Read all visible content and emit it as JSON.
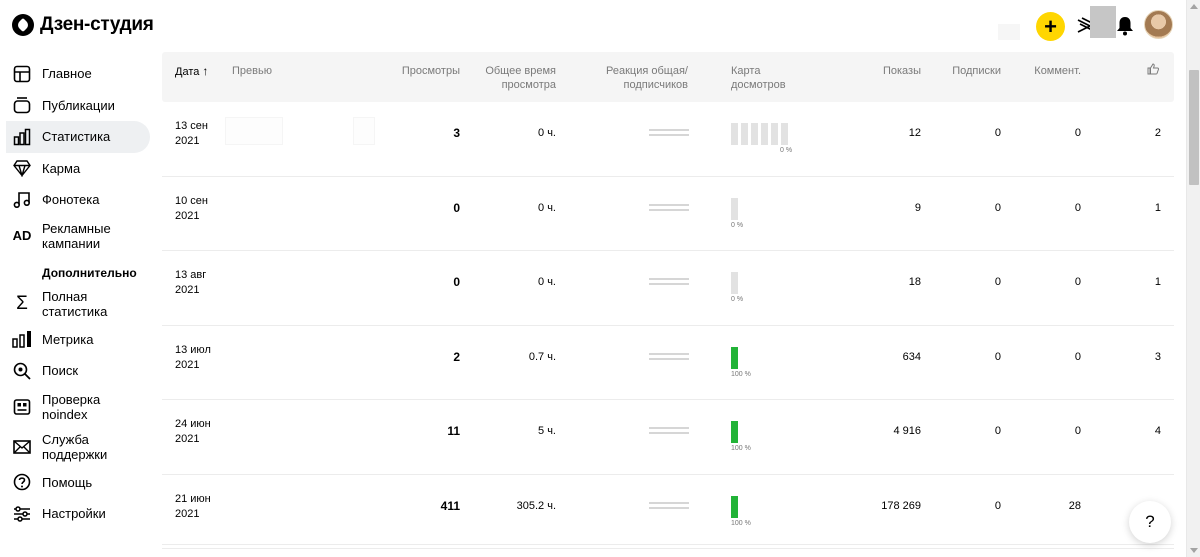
{
  "app": {
    "title": "Дзен-студия"
  },
  "header": {
    "plus_label": "+",
    "help_label": "?"
  },
  "sidebar": {
    "items": [
      {
        "label": "Главное",
        "icon": "layout-icon"
      },
      {
        "label": "Публикации",
        "icon": "publications-icon"
      },
      {
        "label": "Статистика",
        "icon": "bar-chart-icon",
        "active": true
      },
      {
        "label": "Карма",
        "icon": "diamond-icon"
      },
      {
        "label": "Фонотека",
        "icon": "music-icon"
      },
      {
        "label": "Рекламные кампании",
        "icon": "ad-icon",
        "glyph": "AD"
      }
    ],
    "section_title": "Дополнительно",
    "extra_items": [
      {
        "label": "Полная статистика",
        "icon": "sigma-icon",
        "glyph": "Σ"
      },
      {
        "label": "Метрика",
        "icon": "metrika-icon"
      },
      {
        "label": "Поиск",
        "icon": "search-icon"
      },
      {
        "label": "Проверка noindex",
        "icon": "noindex-icon"
      },
      {
        "label": "Служба поддержки",
        "icon": "mail-icon"
      },
      {
        "label": "Помощь",
        "icon": "question-icon"
      },
      {
        "label": "Настройки",
        "icon": "sliders-icon"
      }
    ]
  },
  "table": {
    "columns": {
      "date": "Дата",
      "preview": "Превью",
      "views": "Просмотры",
      "watch_time": "Общее время просмотра",
      "reaction": "Реакция общая/ подписчиков",
      "map": "Карта досмотров",
      "impressions": "Показы",
      "subs": "Подписки",
      "comments": "Коммент."
    },
    "rows": [
      {
        "date": "13 сен 2021",
        "views": "3",
        "time": "0 ч.",
        "map_pct": "0 %",
        "map_bars": 6,
        "green": false,
        "impressions": "12",
        "subs": "0",
        "comments": "0",
        "likes": "2"
      },
      {
        "date": "10 сен 2021",
        "views": "0",
        "time": "0 ч.",
        "map_pct": "0 %",
        "map_bars": 1,
        "green": false,
        "impressions": "9",
        "subs": "0",
        "comments": "0",
        "likes": "1"
      },
      {
        "date": "13 авг 2021",
        "views": "0",
        "time": "0 ч.",
        "map_pct": "0 %",
        "map_bars": 1,
        "green": false,
        "impressions": "18",
        "subs": "0",
        "comments": "0",
        "likes": "1"
      },
      {
        "date": "13 июл 2021",
        "views": "2",
        "time": "0.7 ч.",
        "map_pct": "100 %",
        "map_bars": 1,
        "green": true,
        "impressions": "634",
        "subs": "0",
        "comments": "0",
        "likes": "3"
      },
      {
        "date": "24 июн 2021",
        "views": "11",
        "time": "5 ч.",
        "map_pct": "100 %",
        "map_bars": 1,
        "green": true,
        "impressions": "4 916",
        "subs": "0",
        "comments": "0",
        "likes": "4"
      },
      {
        "date": "21 июн 2021",
        "views": "411",
        "time": "305.2 ч.",
        "map_pct": "100 %",
        "map_bars": 1,
        "green": true,
        "impressions": "178 269",
        "subs": "0",
        "comments": "28",
        "likes": ""
      }
    ]
  },
  "colors": {
    "accent_yellow": "#ffd600",
    "green_bar": "#22b337",
    "grey_bar": "#e2e2e2",
    "active_bg": "#eef0f2"
  }
}
